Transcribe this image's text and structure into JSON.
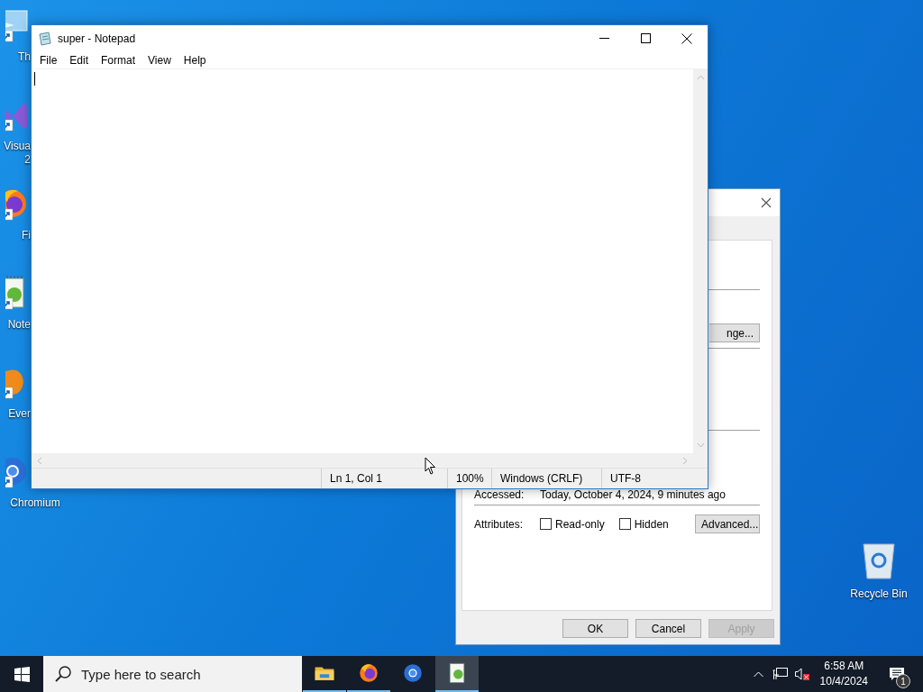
{
  "desktop_icons": [
    {
      "kind": "monitor",
      "lines": [
        "Th"
      ],
      "partly_hidden": true
    },
    {
      "kind": "ribbon",
      "lines": [
        "Visua",
        "2"
      ],
      "partly_hidden": true
    },
    {
      "kind": "flame",
      "lines": [
        "Fi"
      ],
      "partly_hidden": true
    },
    {
      "kind": "notepad",
      "lines": [
        "Note"
      ],
      "partly_hidden": true
    },
    {
      "kind": "leaf",
      "lines": [
        "Ever"
      ],
      "partly_hidden": true
    },
    {
      "kind": "ring",
      "lines": [
        "Chromium"
      ],
      "partly_hidden": false
    }
  ],
  "recycle_bin": {
    "label": "Recycle Bin"
  },
  "properties_dialog": {
    "partial_button": "nge...",
    "accessed": {
      "label": "Accessed:",
      "value": "Today, October 4, 2024, 9 minutes ago"
    },
    "attributes": {
      "label": "Attributes:",
      "checkboxes": [
        {
          "label": "Read-only",
          "checked": false
        },
        {
          "label": "Hidden",
          "checked": false
        }
      ],
      "advanced_button": "Advanced..."
    },
    "buttons": [
      {
        "label": "OK",
        "disabled": false
      },
      {
        "label": "Cancel",
        "disabled": false
      },
      {
        "label": "Apply",
        "disabled": true
      }
    ]
  },
  "notepad": {
    "title": "super - Notepad",
    "menu": [
      "File",
      "Edit",
      "Format",
      "View",
      "Help"
    ],
    "status_bar": [
      "Ln 1, Col 1",
      "100%",
      "Windows (CRLF)",
      "UTF-8"
    ]
  },
  "taskbar": {
    "search": {
      "placeholder": "Type here to search"
    },
    "apps": [
      {
        "kind": "folder",
        "running": true,
        "active": false
      },
      {
        "kind": "flame",
        "running": true,
        "active": false
      },
      {
        "kind": "ring",
        "running": false,
        "active": false
      },
      {
        "kind": "notepad",
        "running": true,
        "active": true
      }
    ],
    "clock": {
      "time": "6:58 AM",
      "date": "10/4/2024"
    },
    "notifications": {
      "count": "1"
    }
  }
}
